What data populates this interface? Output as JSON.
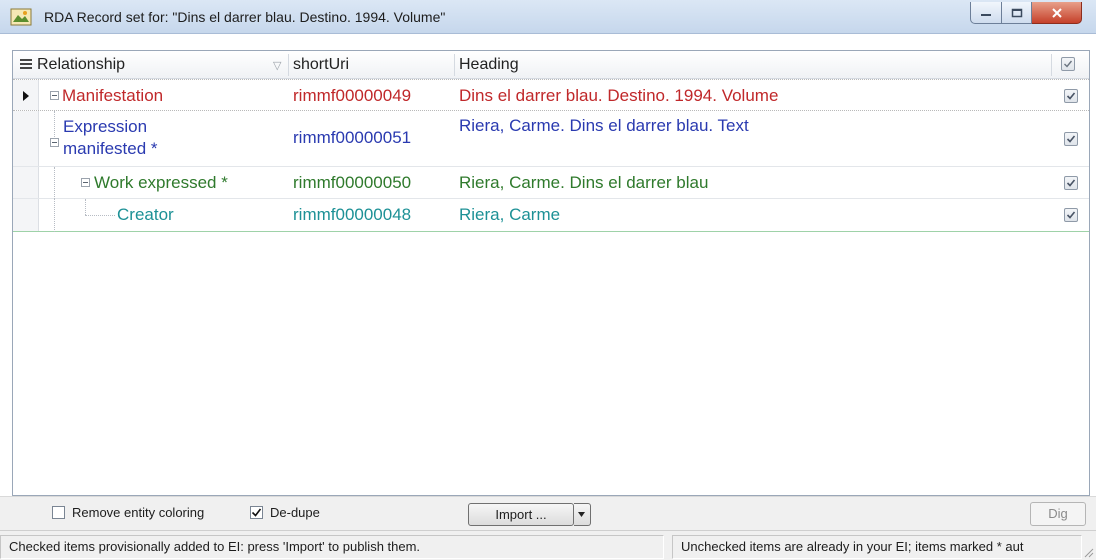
{
  "window": {
    "title": "RDA Record set for: \"Dins el darrer blau. Destino. 1994. Volume\""
  },
  "grid": {
    "columns": {
      "relationship": "Relationship",
      "shortUri": "shortUri",
      "heading": "Heading"
    },
    "rows": [
      {
        "relationship": "Manifestation",
        "shortUri": "rimmf00000049",
        "heading": "Dins el darrer blau. Destino. 1994. Volume",
        "checked": true,
        "color": "#c0282a"
      },
      {
        "relationship_line1": "Expression",
        "relationship_line2": "manifested *",
        "shortUri": "rimmf00000051",
        "heading": "Riera, Carme. Dins el darrer blau. Text",
        "checked": true,
        "color": "#2a3ab0"
      },
      {
        "relationship": "Work expressed *",
        "shortUri": "rimmf00000050",
        "heading": "Riera, Carme. Dins el darrer blau",
        "checked": true,
        "color": "#2f7a2c"
      },
      {
        "relationship": "Creator",
        "shortUri": "rimmf00000048",
        "heading": "Riera, Carme",
        "checked": true,
        "color": "#1d9196"
      }
    ]
  },
  "toolbar": {
    "remove_coloring": {
      "label": "Remove entity coloring",
      "checked": false
    },
    "dedupe": {
      "label": "De-dupe",
      "checked": true
    },
    "import_label": "Import ...",
    "dig_label": "Dig"
  },
  "status": {
    "left": "Checked items provisionally added to EI: press 'Import' to publish them.",
    "right": "Unchecked items are already in your EI; items marked * aut"
  }
}
